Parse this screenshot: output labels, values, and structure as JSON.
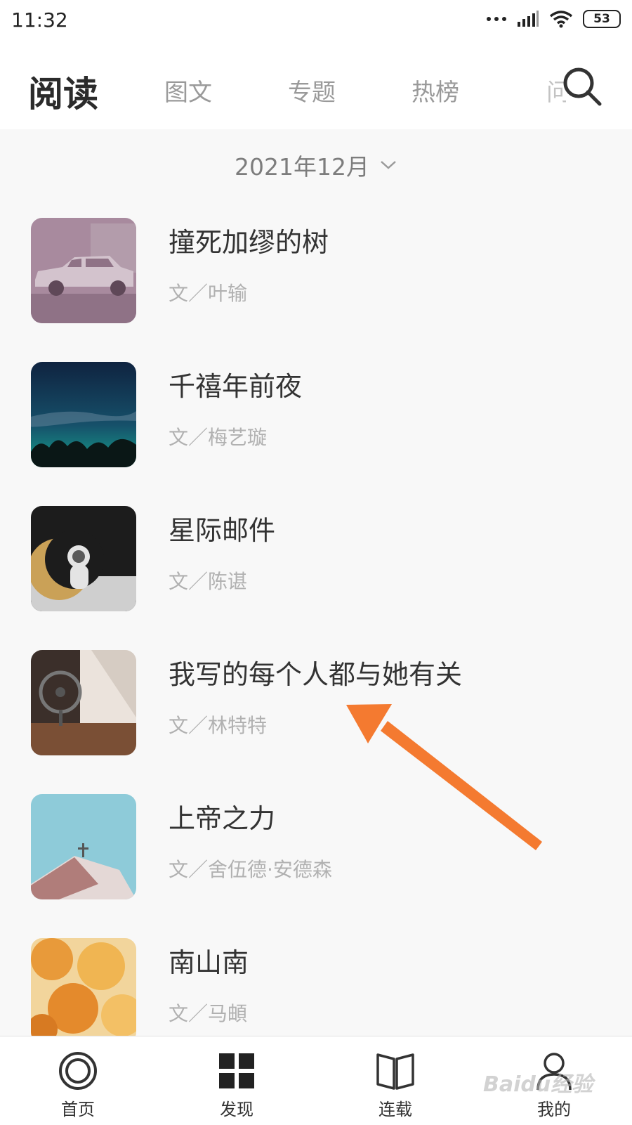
{
  "status_bar": {
    "time": "11:32",
    "battery": "53"
  },
  "header": {
    "title": "阅读",
    "tabs": [
      {
        "label": "图文"
      },
      {
        "label": "专题"
      },
      {
        "label": "热榜"
      },
      {
        "label": "问"
      }
    ]
  },
  "filter": {
    "date": "2021年12月"
  },
  "articles": [
    {
      "title": "撞死加缪的树",
      "author": "文／叶输"
    },
    {
      "title": "千禧年前夜",
      "author": "文／梅艺璇"
    },
    {
      "title": "星际邮件",
      "author": "文／陈谌"
    },
    {
      "title": "我写的每个人都与她有关",
      "author": "文／林特特"
    },
    {
      "title": "上帝之力",
      "author": "文／舍伍德·安德森"
    },
    {
      "title": "南山南",
      "author": "文／马頔"
    }
  ],
  "bottom_nav": {
    "items": [
      {
        "label": "首页",
        "icon": "home-circle-icon"
      },
      {
        "label": "发现",
        "icon": "grid-icon"
      },
      {
        "label": "连载",
        "icon": "book-icon"
      },
      {
        "label": "我的",
        "icon": "person-icon"
      }
    ]
  },
  "watermark": {
    "text": "Baidu经验"
  },
  "colors": {
    "arrow": "#f47a30",
    "title": "#2b2b2b",
    "muted": "#b1b1b1"
  }
}
